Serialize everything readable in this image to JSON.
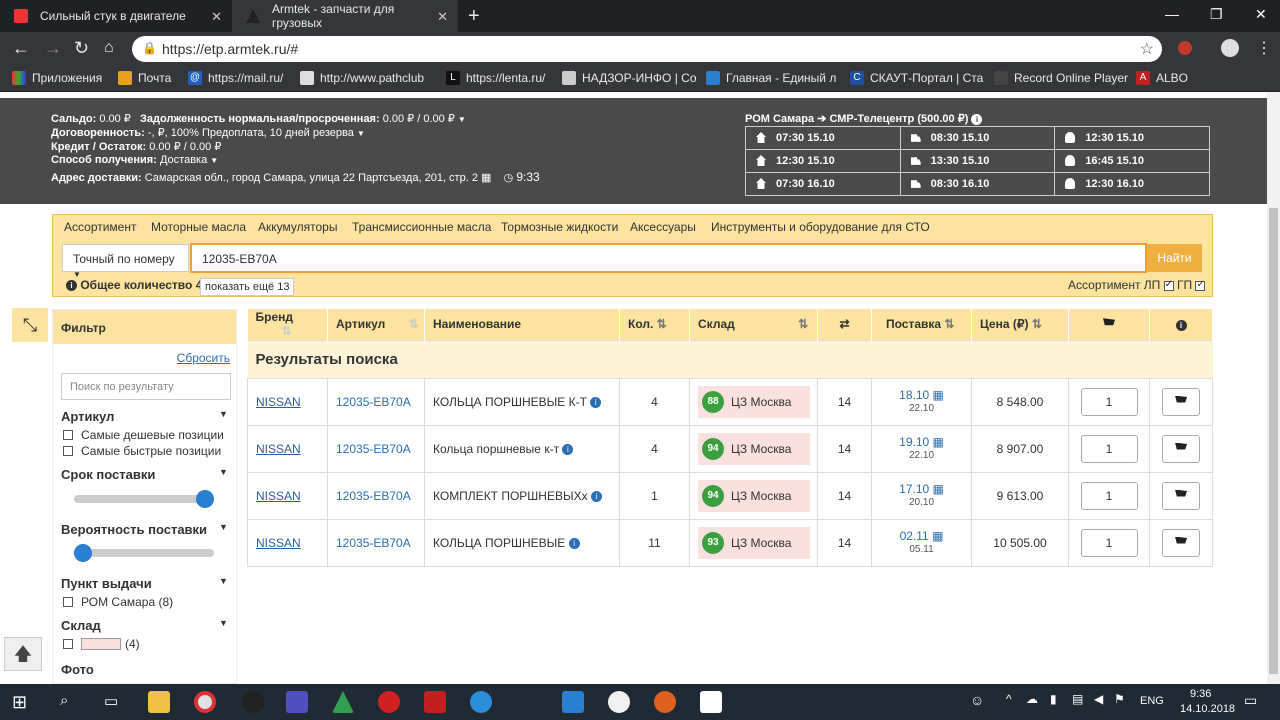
{
  "browser": {
    "tabs": [
      {
        "title": "Сильный стук в двигателе"
      },
      {
        "title": "Armtek - запчасти для грузовых"
      }
    ],
    "url": "https://etp.armtek.ru/#",
    "bookmarks": [
      "Приложения",
      "Почта",
      "https://mail.ru/",
      "http://www.pathclub",
      "https://lenta.ru/",
      "НАДЗОР-ИНФО | Со",
      "Главная - Единый л",
      "СКАУТ-Портал | Ста",
      "Record Online Player",
      "ALBO"
    ]
  },
  "account": {
    "saldo_label": "Сальдо:",
    "saldo_value": "0.00 ₽",
    "debt_label": "Задолженность нормальная/просроченная:",
    "debt_value": "0.00 ₽ / 0.00 ₽",
    "agreement_label": "Договоренность:",
    "agreement_value": "-, ₽, 100% Предоплата, 10 дней резерва",
    "credit_label": "Кредит / Остаток:",
    "credit_value": "0.00 ₽ / 0.00 ₽",
    "method_label": "Способ получения:",
    "method_value": "Доставка",
    "address_label": "Адрес доставки:",
    "address_value": "Самарская обл., город Самара, улица 22 Партсъезда, 201, стр. 2",
    "time": "9:33",
    "route": "РОМ Самара ➔ СМР-Телецентр (500.00 ₽)",
    "schedule": [
      [
        "07:30 15.10",
        "08:30 15.10",
        "12:30 15.10"
      ],
      [
        "12:30 15.10",
        "13:30 15.10",
        "16:45 15.10"
      ],
      [
        "07:30 16.10",
        "08:30 16.10",
        "12:30 16.10"
      ]
    ]
  },
  "catalog_menu": [
    "Ассортимент",
    "Моторные масла",
    "Аккумуляторы",
    "Трансмиссионные масла",
    "Тормозные жидкости",
    "Аксессуары",
    "Инструменты и оборудование для СТО"
  ],
  "search": {
    "mode": "Точный по номеру",
    "query": "12035-EB70A",
    "button": "Найти",
    "count_label": "Общее количество 4",
    "more_label": "показать ещё 13",
    "assort_label": "Ассортимент ЛП",
    "gp_label": "ГП"
  },
  "filter": {
    "title": "Фильтр",
    "reset": "Сбросить",
    "search_placeholder": "Поиск по результату",
    "sections": {
      "article": "Артикул",
      "delivery": "Срок поставки",
      "probability": "Вероятность поставки",
      "pickup": "Пункт выдачи",
      "warehouse": "Склад",
      "photo": "Фото"
    },
    "opts": {
      "cheap": "Самые дешевые позиции",
      "fast": "Самые быстрые позиции",
      "pickup_rom": "РОМ Самара (8)",
      "wh_count": "(4)"
    },
    "delivery_level": 1.0,
    "probability_level": 0.0
  },
  "results": {
    "headers": [
      "Бренд",
      "Артикул",
      "Наименование",
      "Кол.",
      "Склад",
      "",
      "Поставка",
      "Цена (₽)",
      "",
      ""
    ],
    "title": "Результаты поиска",
    "rows": [
      {
        "brand": "NISSAN",
        "article": "12035-EB70A",
        "name": "КОЛЬЦА ПОРШНЕВЫЕ К-Т",
        "qty": "4",
        "pct": "88",
        "wh": "ЦЗ Москва",
        "days": "14",
        "d1": "18.10",
        "d2": "22.10",
        "price": "8 548.00",
        "order": "1"
      },
      {
        "brand": "NISSAN",
        "article": "12035-EB70A",
        "name": "Кольца поршневые к-т",
        "qty": "4",
        "pct": "94",
        "wh": "ЦЗ Москва",
        "days": "14",
        "d1": "19.10",
        "d2": "22.10",
        "price": "8 907.00",
        "order": "1"
      },
      {
        "brand": "NISSAN",
        "article": "12035-EB70A",
        "name": "КОМПЛЕКТ ПОРШНЕВЫХх",
        "qty": "1",
        "pct": "94",
        "wh": "ЦЗ Москва",
        "days": "14",
        "d1": "17.10",
        "d2": "20.10",
        "price": "9 613.00",
        "order": "1"
      },
      {
        "brand": "NISSAN",
        "article": "12035-EB70A",
        "name": "КОЛЬЦА ПОРШНЕВЫЕ",
        "qty": "11",
        "pct": "93",
        "wh": "ЦЗ Москва",
        "days": "14",
        "d1": "02.11",
        "d2": "05.11",
        "price": "10 505.00",
        "order": "1"
      }
    ]
  },
  "taskbar": {
    "lang": "ENG",
    "time": "9:36",
    "date": "14.10.2018"
  }
}
